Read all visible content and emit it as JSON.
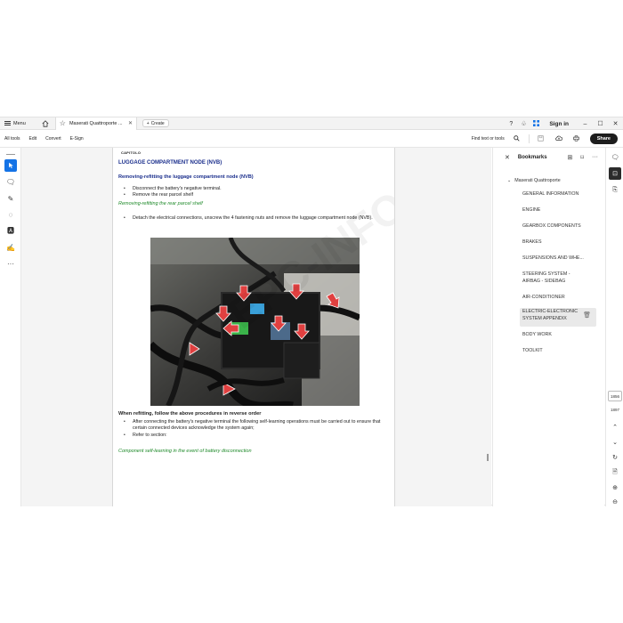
{
  "tabbar": {
    "menu_label": "Menu",
    "tab_title": "Maserati Quattroporte ...",
    "create_label": "Create",
    "signin_label": "Sign in"
  },
  "toolbar": {
    "items": [
      "All tools",
      "Edit",
      "Convert",
      "E-Sign"
    ],
    "find_label": "Find text or tools",
    "share_label": "Share"
  },
  "document": {
    "caption": "CAPITOLO",
    "heading": "LUGGAGE COMPARTMENT NODE (NVB)",
    "subheading": "Removing-refitting the luggage compartment node (NVB)",
    "steps_a": [
      "Disconnect the battery's negative terminal.",
      "Remove the rear parcel shelf"
    ],
    "link_a": "Removing-refitting the rear parcel shelf",
    "steps_b": [
      "Detach the electrical connections, unscrew the 4 fastening nuts and remove the luggage compartment node (NVB)."
    ],
    "refit_note": "When refitting, follow the above procedures in reverse order",
    "steps_c": [
      "After connecting the battery's negative terminal the following self-learning operations must be carried out to ensure that certain connected devices acknowledge the system again;",
      "Refer to section:"
    ],
    "link_b": "Component self-learning in the event of battery disconnection",
    "watermark": "EPC-INFO.COM"
  },
  "bookmarks": {
    "title": "Bookmarks",
    "root": "Maserati Quattroporte",
    "items": [
      "GENERAL INFORMATION",
      "ENGINE",
      "GEARBOX COMPONENTS",
      "BRAKES",
      "SUSPENSIONS AND WHE...",
      "STEERING SYSTEM - AIRBAG - SIDEBAG",
      "AIR-CONDITIONER",
      "ELECTRIC-ELECTRONIC SYSTEM APPENDIX",
      "BODY WORK",
      "TOOLKIT"
    ],
    "selected_index": 7
  },
  "pagination": {
    "current": "1856",
    "total": "1897"
  },
  "colors": {
    "accent": "#1473e6",
    "heading_blue": "#1a2e8c",
    "link_green": "#1f8a2a",
    "arrow_red": "#e04040"
  }
}
